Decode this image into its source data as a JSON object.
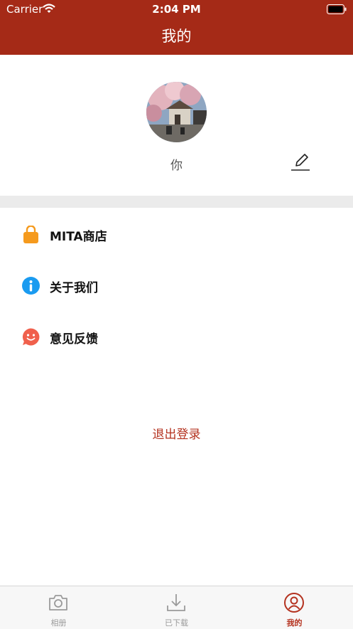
{
  "status_bar": {
    "carrier": "Carrier",
    "time": "2:04 PM"
  },
  "nav": {
    "title": "我的"
  },
  "profile": {
    "username": "你"
  },
  "menu": {
    "items": [
      {
        "label": "MITA商店",
        "icon": "shopping-bag-icon",
        "color": "#f59a1d"
      },
      {
        "label": "关于我们",
        "icon": "info-icon",
        "color": "#1a9bf0"
      },
      {
        "label": "意见反馈",
        "icon": "feedback-smile-icon",
        "color": "#f0604c"
      }
    ]
  },
  "logout": {
    "label": "退出登录"
  },
  "tabbar": {
    "tabs": [
      {
        "label": "相册",
        "icon": "camera-icon",
        "active": false
      },
      {
        "label": "已下载",
        "icon": "download-icon",
        "active": false
      },
      {
        "label": "我的",
        "icon": "user-circle-icon",
        "active": true
      }
    ]
  },
  "colors": {
    "primary": "#a52a17",
    "accent_text": "#b4321f",
    "inactive_tab": "#9a9a9a",
    "divider": "#ebebeb"
  }
}
